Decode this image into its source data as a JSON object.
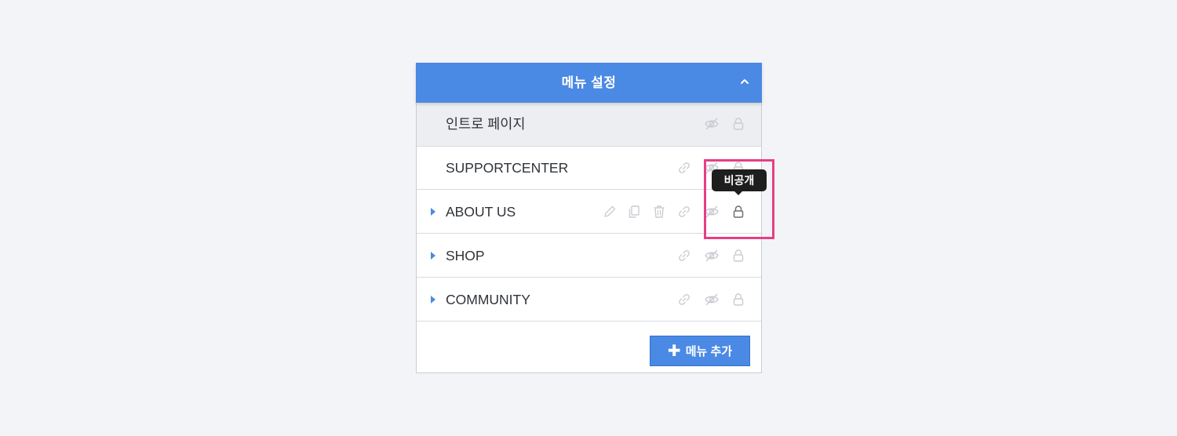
{
  "panel": {
    "title": "메뉴 설정",
    "collapse_icon": "chevron-up-icon"
  },
  "menu_items": [
    {
      "label": "인트로 페이지",
      "expandable": false,
      "selected": true,
      "icons": [
        "eye-off-icon",
        "lock-icon"
      ]
    },
    {
      "label": "SUPPORTCENTER",
      "expandable": false,
      "icons": [
        "link-icon",
        "eye-off-icon",
        "lock-icon"
      ]
    },
    {
      "label": "ABOUT US",
      "expandable": true,
      "hovered": true,
      "icons": [
        "pencil-icon",
        "copy-icon",
        "trash-icon",
        "link-icon",
        "eye-off-icon",
        "lock-icon"
      ]
    },
    {
      "label": "SHOP",
      "expandable": true,
      "icons": [
        "link-icon",
        "eye-off-icon",
        "lock-icon"
      ]
    },
    {
      "label": "COMMUNITY",
      "expandable": true,
      "icons": [
        "link-icon",
        "eye-off-icon",
        "lock-icon"
      ]
    }
  ],
  "add_button": {
    "label": "메뉴 추가",
    "icon": "plus-icon"
  },
  "tooltip": {
    "text": "비공개"
  },
  "colors": {
    "accent": "#4a89e4",
    "highlight": "#e83e86",
    "icon_light": "#c9ccd2",
    "icon_active": "#6b6f76"
  }
}
